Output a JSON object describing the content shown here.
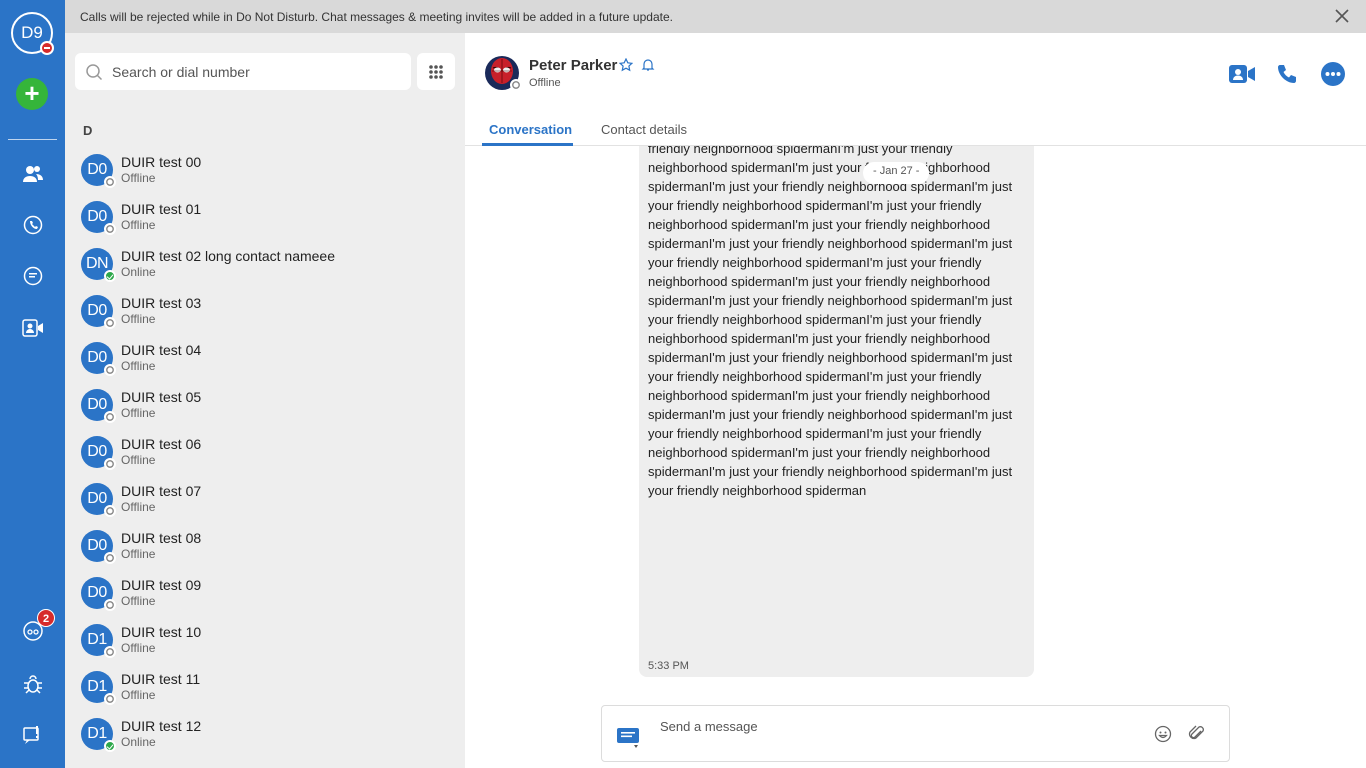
{
  "banner": {
    "text": "Calls will be rejected while in Do Not Disturb. Chat messages & meeting invites will be added in a future update."
  },
  "rail": {
    "me_initials": "D9",
    "notification_count": "2",
    "accent": "#2b74c7"
  },
  "contacts": {
    "search_placeholder": "Search or dial number",
    "section_letter": "D",
    "items": [
      {
        "initials": "D0",
        "name": "DUIR test 00",
        "status": "Offline"
      },
      {
        "initials": "D0",
        "name": "DUIR test 01",
        "status": "Offline"
      },
      {
        "initials": "DN",
        "name": "DUIR test 02 long contact nameee",
        "status": "Online"
      },
      {
        "initials": "D0",
        "name": "DUIR test 03",
        "status": "Offline"
      },
      {
        "initials": "D0",
        "name": "DUIR test 04",
        "status": "Offline"
      },
      {
        "initials": "D0",
        "name": "DUIR test 05",
        "status": "Offline"
      },
      {
        "initials": "D0",
        "name": "DUIR test 06",
        "status": "Offline"
      },
      {
        "initials": "D0",
        "name": "DUIR test 07",
        "status": "Offline"
      },
      {
        "initials": "D0",
        "name": "DUIR test 08",
        "status": "Offline"
      },
      {
        "initials": "D0",
        "name": "DUIR test 09",
        "status": "Offline"
      },
      {
        "initials": "D1",
        "name": "DUIR test 10",
        "status": "Offline"
      },
      {
        "initials": "D1",
        "name": "DUIR test 11",
        "status": "Offline"
      },
      {
        "initials": "D1",
        "name": "DUIR test 12",
        "status": "Online"
      }
    ]
  },
  "header": {
    "name": "Peter Parker",
    "status": "Offline"
  },
  "tabs": {
    "conversation": "Conversation",
    "details": "Contact details"
  },
  "conversation": {
    "date_pill": "- Jan 27 -",
    "message": "friendly neighborhood spidermanI'm just your friendly neighborhood spidermanI'm just your friendly neighborhood spidermanI'm just your friendly neighborhood spidermanI'm just your friendly neighborhood spidermanI'm just your friendly neighborhood spidermanI'm just your friendly neighborhood spidermanI'm just your friendly neighborhood spidermanI'm just your friendly neighborhood spidermanI'm just your friendly neighborhood spidermanI'm just your friendly neighborhood spidermanI'm just your friendly neighborhood spidermanI'm just your friendly neighborhood spidermanI'm just your friendly neighborhood spidermanI'm just your friendly neighborhood spidermanI'm just your friendly neighborhood spidermanI'm just your friendly neighborhood spidermanI'm just your friendly neighborhood spidermanI'm just your friendly neighborhood spidermanI'm just your friendly neighborhood spidermanI'm just your friendly neighborhood spidermanI'm just your friendly neighborhood spidermanI'm just your friendly neighborhood spidermanI'm just your friendly neighborhood spidermanI'm just your friendly neighborhood spiderman",
    "time": "5:33 PM"
  },
  "composer": {
    "placeholder": "Send a message"
  }
}
